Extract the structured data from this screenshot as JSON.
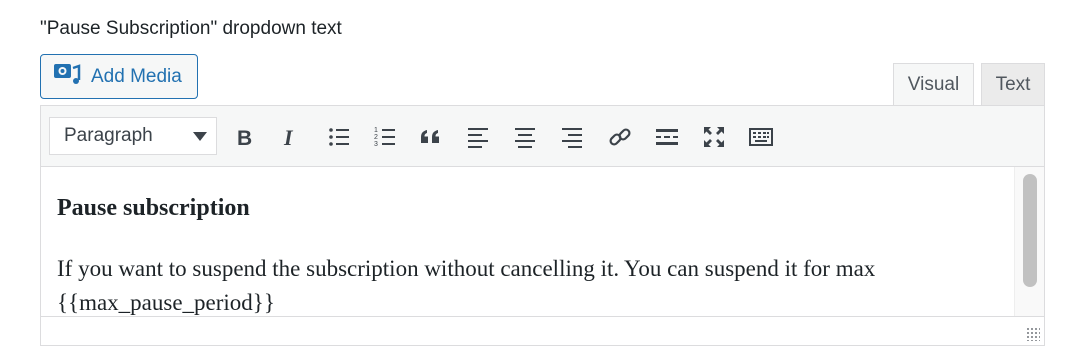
{
  "field": {
    "label": "\"Pause Subscription\" dropdown text"
  },
  "media": {
    "add_label": "Add Media"
  },
  "tabs": [
    {
      "label": "Visual"
    },
    {
      "label": "Text"
    }
  ],
  "toolbar": {
    "format_value": "Paragraph",
    "buttons": [
      {
        "name": "bold",
        "icon": "bold-icon"
      },
      {
        "name": "italic",
        "icon": "italic-icon"
      },
      {
        "name": "bulleted-list",
        "icon": "bulleted-list-icon"
      },
      {
        "name": "numbered-list",
        "icon": "numbered-list-icon"
      },
      {
        "name": "blockquote",
        "icon": "blockquote-icon"
      },
      {
        "name": "align-left",
        "icon": "align-left-icon"
      },
      {
        "name": "align-center",
        "icon": "align-center-icon"
      },
      {
        "name": "align-right",
        "icon": "align-right-icon"
      },
      {
        "name": "insert-link",
        "icon": "link-icon"
      },
      {
        "name": "read-more",
        "icon": "read-more-icon"
      },
      {
        "name": "fullscreen",
        "icon": "fullscreen-icon"
      },
      {
        "name": "toolbar-toggle",
        "icon": "keyboard-icon"
      }
    ]
  },
  "content": {
    "heading": "Pause subscription",
    "paragraph": "If you want to suspend the subscription without cancelling it. You can suspend it for max {{max_pause_period}}"
  },
  "colors": {
    "accent": "#2271b1",
    "border": "#dcdcde",
    "toolbar_bg": "#f6f7f7",
    "text": "#1d2327"
  }
}
